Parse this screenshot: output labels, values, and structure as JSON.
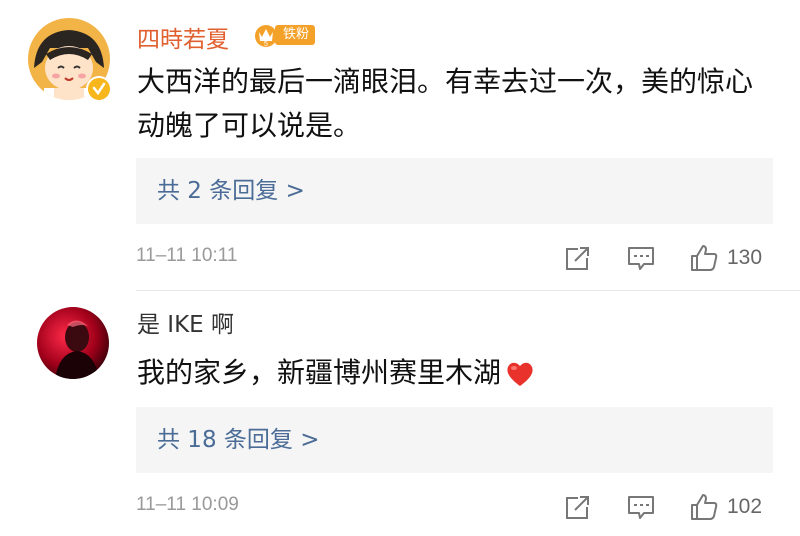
{
  "comments": [
    {
      "username": "四時若夏",
      "fan_badge": "铁粉",
      "text": "大西洋的最后一滴眼泪。有幸去过一次，美的惊心动魄了可以说是。",
      "replies_label": "共 2 条回复 >",
      "timestamp": "11–11 10:11",
      "likes": "130",
      "avatar_icon": "cartoon-girl-avatar",
      "verified_icon": "verified-badge-icon"
    },
    {
      "username": "是 IKE 啊",
      "text": "我的家乡，新疆博州赛里木湖",
      "emoji": "heart-emoji",
      "replies_label": "共 18 条回复 >",
      "timestamp": "11–11 10:09",
      "likes": "102",
      "avatar_icon": "red-photo-avatar"
    }
  ],
  "colors": {
    "username_accent": "#e0602f",
    "link_blue": "#4a6c96",
    "badge_gold": "#f4a12a",
    "meta_gray": "#999999",
    "reply_box_bg": "#f5f5f5"
  }
}
